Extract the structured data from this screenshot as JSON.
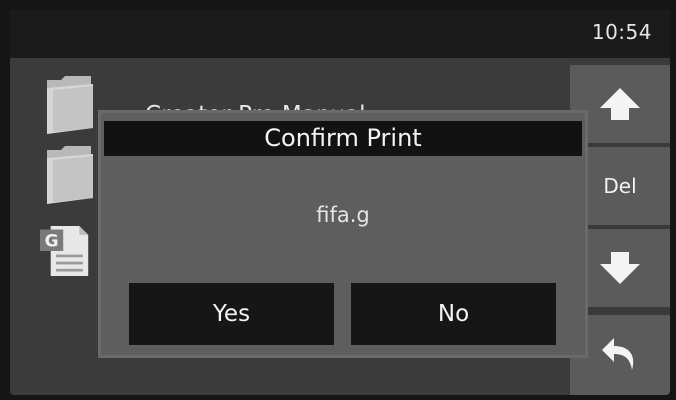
{
  "status_bar": {
    "time": "10:54"
  },
  "file_list": {
    "items": [
      {
        "name": "Creator Pro Manual",
        "icon": "folder-icon"
      },
      {
        "name": "",
        "icon": "folder-icon"
      },
      {
        "name": "",
        "icon": "gcode-file-icon",
        "icon_letter": "G"
      }
    ]
  },
  "side_panel": {
    "up_icon": "arrow-up-icon",
    "delete_label": "Del",
    "down_icon": "arrow-down-icon",
    "back_icon": "back-arrow-icon"
  },
  "dialog": {
    "title": "Confirm Print",
    "filename": "fifa.g",
    "yes_label": "Yes",
    "no_label": "No"
  },
  "colors": {
    "screen_background": "#3a3a3a",
    "title_bar": "#121212",
    "dialog_body": "#5e5e5e",
    "side_button": "#5b5b5b",
    "text": "#f4f4f4"
  }
}
